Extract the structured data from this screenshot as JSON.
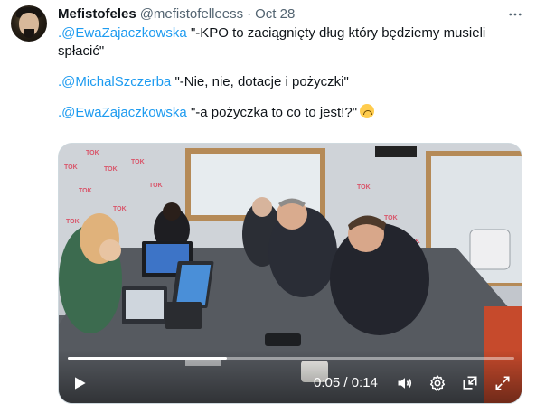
{
  "tweet": {
    "display_name": "Mefistofeles",
    "handle": "@mefistofelleess",
    "separator": "·",
    "date": "Oct 28",
    "more_icon": "more-horizontal-icon",
    "lines": {
      "l1": {
        "mention": ".@EwaZajaczkowska",
        "text": " \"-KPO to zaciągnięty dług który będziemy musieli"
      },
      "l2": {
        "text": "spłacić\""
      },
      "l3": {
        "mention": ".@MichalSzczerba",
        "text": " \"-Nie, nie, dotacje i pożyczki\""
      },
      "l4": {
        "mention": ".@EwaZajaczkowska",
        "text": " \"-a pożyczka to co to jest!?\"",
        "emoji": "upside-down-face"
      }
    }
  },
  "video": {
    "time": "0:05 / 0:14",
    "progress": 0.357,
    "icons": {
      "play": "play-icon",
      "volume": "volume-icon",
      "settings": "settings-gear-icon",
      "pip": "picture-in-picture-icon",
      "fullscreen": "fullscreen-icon"
    },
    "scene_logo": "TOK"
  },
  "colors": {
    "mention": "#1d9bf0",
    "text": "#0f1419",
    "secondary": "#536471",
    "border": "#cfd9de"
  }
}
